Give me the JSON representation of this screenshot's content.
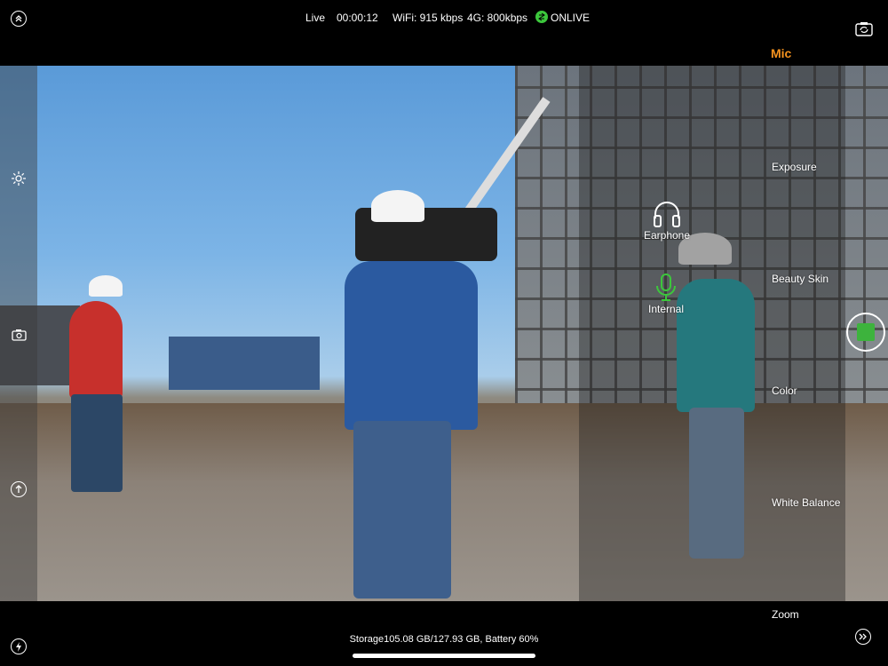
{
  "status_bar": {
    "mode": "Live",
    "timer": "00:00:12",
    "wifi": "WiFi: 915 kbps",
    "cellular": "4G: 800kbps",
    "online": "ONLIVE",
    "online_color": "#3cc73c"
  },
  "mic_panel": {
    "title": "Mic",
    "title_color": "#f7931e",
    "options": [
      {
        "label": "Earphone",
        "icon": "headphones-icon"
      },
      {
        "label": "Internal",
        "icon": "microphone-icon",
        "active_color": "#3cc73c"
      }
    ]
  },
  "settings_menu": {
    "items": [
      "Exposure",
      "Beauty Skin",
      "Color",
      "White Balance",
      "Zoom"
    ]
  },
  "record_button": {
    "color": "#3db33d"
  },
  "footer": {
    "storage": "Storage105.08 GB/127.93 GB, Battery 60%"
  },
  "icons": {
    "top_left": "chevron-up-circle-icon",
    "top_right": "camera-switch-icon",
    "left_settings": "gear-icon",
    "left_snapshot": "camera-icon",
    "left_upload": "arrow-up-circle-icon",
    "bottom_left": "flash-icon",
    "bottom_right": "fast-forward-circle-icon"
  }
}
